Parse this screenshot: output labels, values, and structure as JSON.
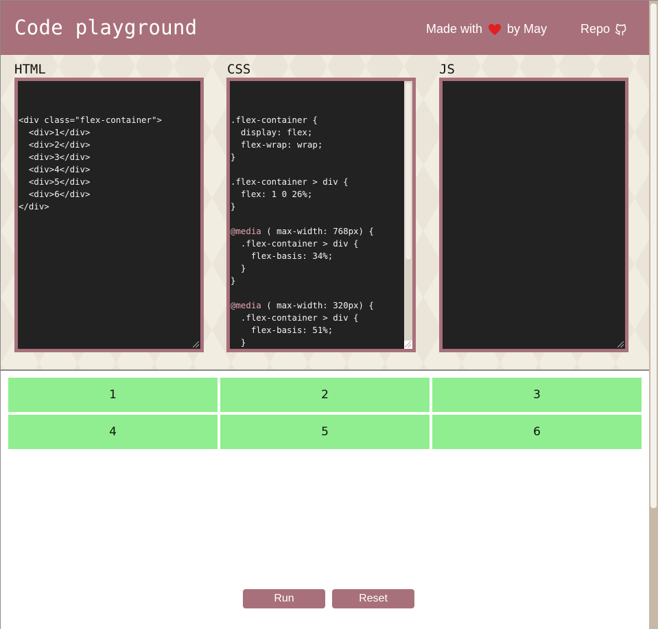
{
  "header": {
    "title": "Code playground",
    "made_with": "Made with",
    "by": "by May",
    "repo": "Repo",
    "heart_color": "#e02020"
  },
  "panels": {
    "html": {
      "label": "HTML",
      "code": "<div class=\"flex-container\">\n  <div>1</div>\n  <div>2</div>\n  <div>3</div>\n  <div>4</div>\n  <div>5</div>\n  <div>6</div>\n</div>"
    },
    "css": {
      "label": "CSS",
      "code": ".flex-container {\n  display: flex;\n  flex-wrap: wrap;\n}\n\n.flex-container > div {\n  flex: 1 0 26%;\n}\n\n@media ( max-width: 768px) {\n  .flex-container > div {\n    flex-basis: 34%;\n  }\n}\n\n@media ( max-width: 320px) {\n  .flex-container > div {\n    flex-basis: 51%;\n  }\n}"
    },
    "js": {
      "label": "JS",
      "code": ""
    }
  },
  "preview": {
    "cells": [
      "1",
      "2",
      "3",
      "4",
      "5",
      "6"
    ],
    "cell_color": "#90ee90"
  },
  "buttons": {
    "run": "Run",
    "reset": "Reset"
  },
  "colors": {
    "accent": "#a8707a",
    "editor_bg": "#222222"
  }
}
